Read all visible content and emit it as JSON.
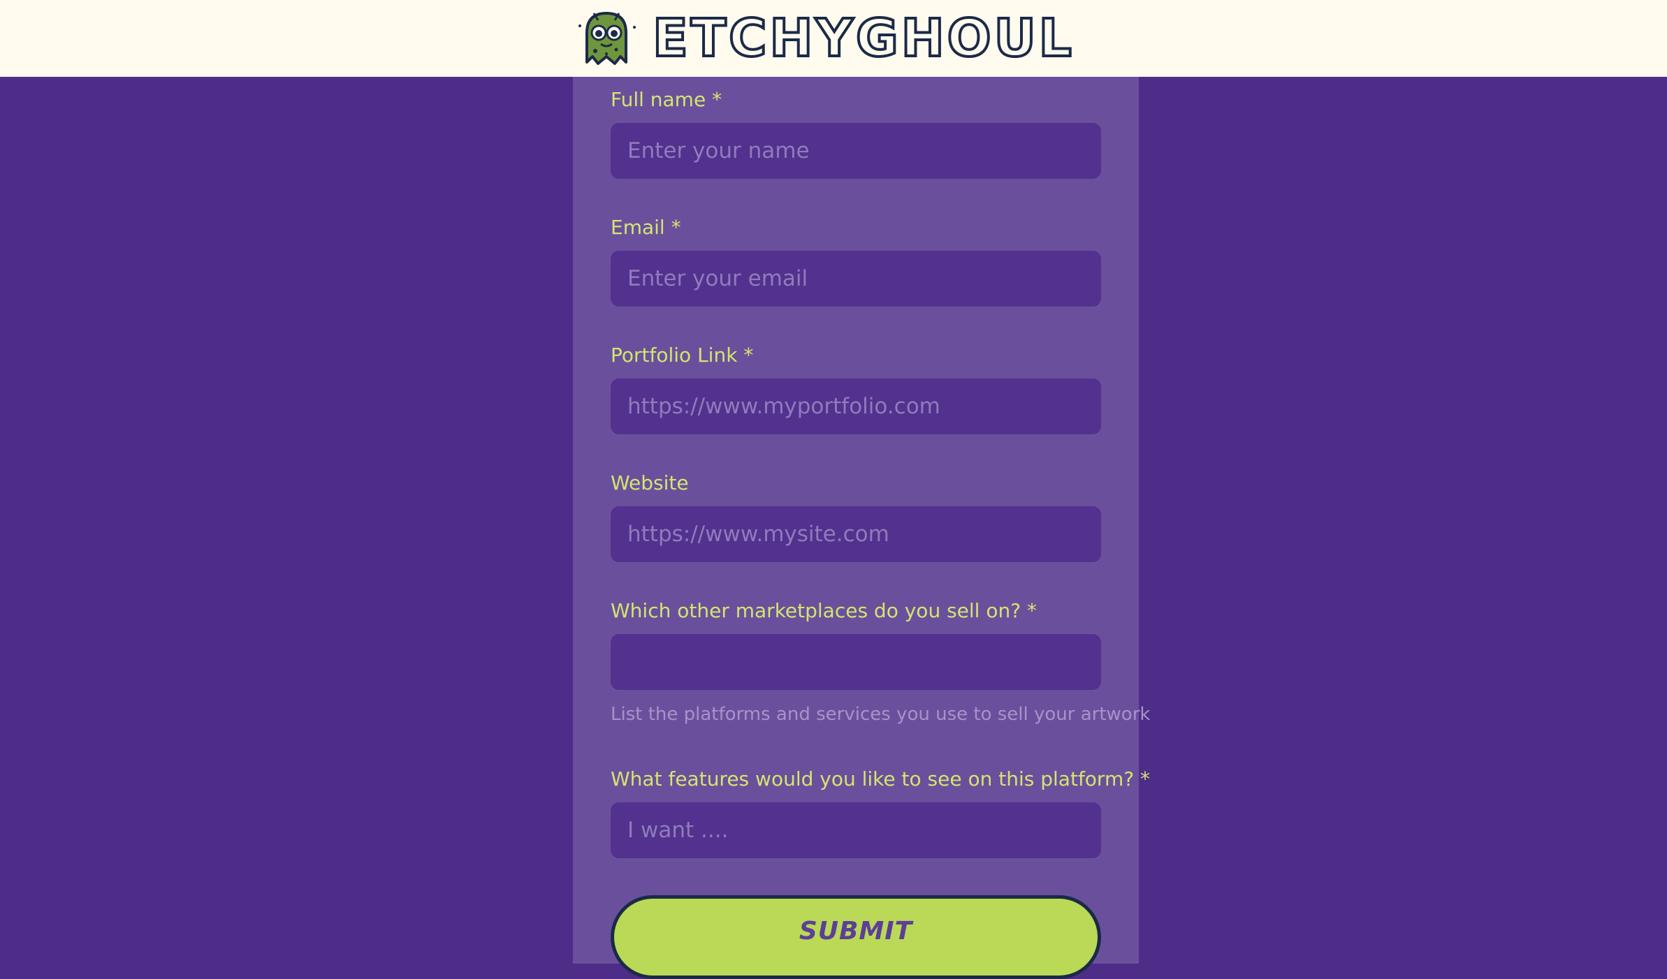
{
  "brand": {
    "name": "ETCHYGHOUL",
    "mascot_icon": "green-ghoul-mascot"
  },
  "form": {
    "fields": [
      {
        "label": "Full name *",
        "placeholder": "Enter your name"
      },
      {
        "label": "Email *",
        "placeholder": "Enter your email"
      },
      {
        "label": "Portfolio Link *",
        "placeholder": "https://www.myportfolio.com"
      },
      {
        "label": "Website",
        "placeholder": "https://www.mysite.com"
      },
      {
        "label": "Which other marketplaces do you sell on? *",
        "placeholder": "",
        "helper": "List the platforms and services you use to sell your artwork"
      },
      {
        "label": "What features would you like to see on this platform? *",
        "placeholder": "I want ...."
      }
    ],
    "submit_label": "SUBMIT"
  },
  "colors": {
    "page_bg": "#4e2d89",
    "panel_bg": "#6a509c",
    "input_bg": "#53318e",
    "label": "#d5e470",
    "accent": "#b9d957",
    "outline": "#1b2a47",
    "header_bg": "#fffbef"
  }
}
